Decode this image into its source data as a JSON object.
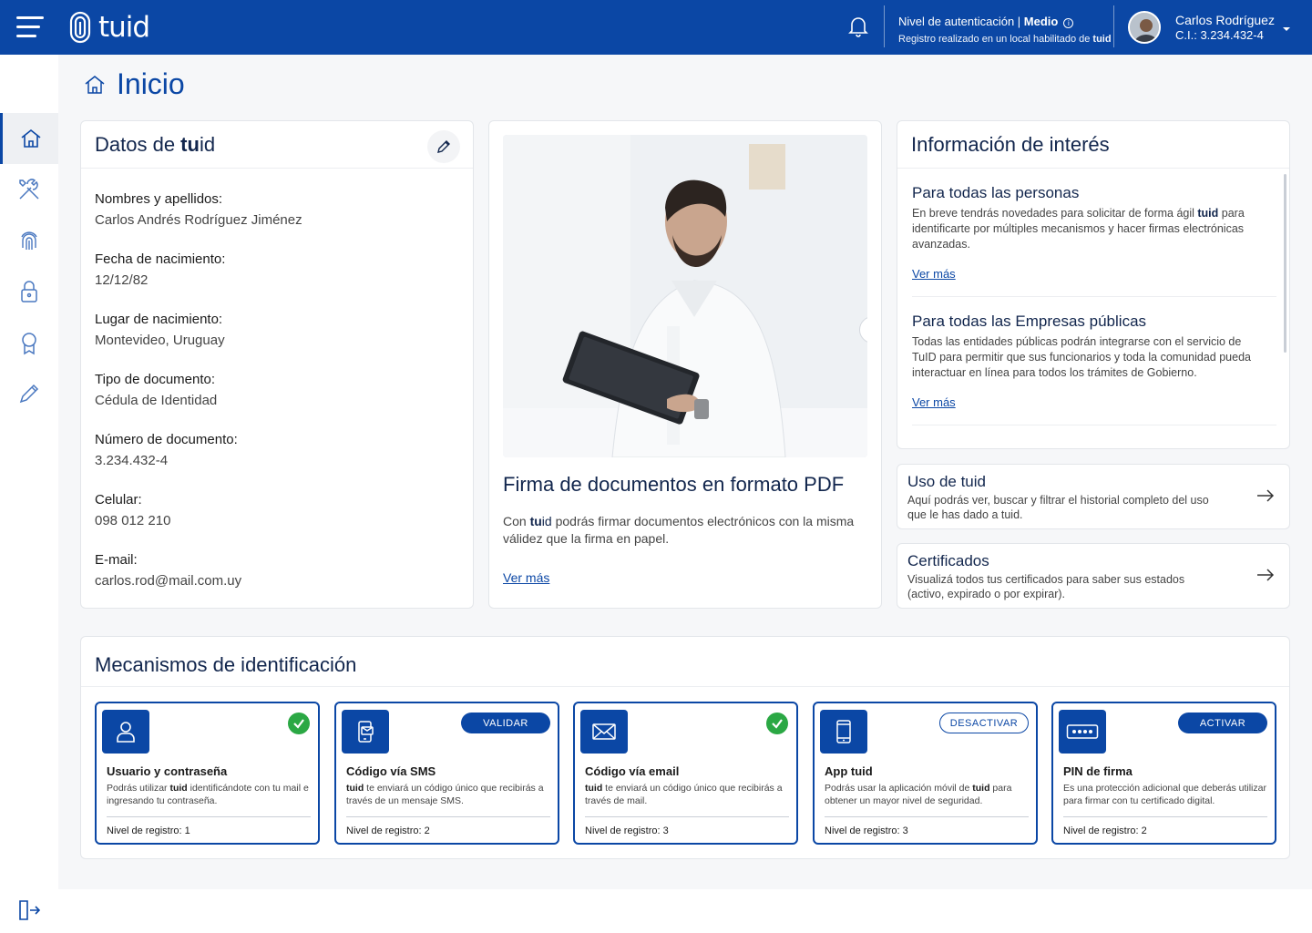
{
  "header": {
    "logo_text": "tuid",
    "auth_level_label": "Nivel de autenticación | ",
    "auth_level_value": "Medio",
    "registro_text": "Registro realizado en un local habilitado de ",
    "registro_brand": "tuid",
    "user_name": "Carlos Rodríguez",
    "user_ci": "C.I.: 3.234.432-4"
  },
  "page": {
    "title": "Inicio"
  },
  "datos": {
    "title_pre": "Datos de ",
    "title_bold": "tu",
    "title_post": "id",
    "fields": [
      {
        "label": "Nombres y apellidos:",
        "value": "Carlos Andrés Rodríguez Jiménez"
      },
      {
        "label": "Fecha de nacimiento:",
        "value": "12/12/82"
      },
      {
        "label": "Lugar de nacimiento:",
        "value": "Montevideo, Uruguay"
      },
      {
        "label": "Tipo de documento:",
        "value": "Cédula de Identidad"
      },
      {
        "label": "Número de documento:",
        "value": "3.234.432-4"
      },
      {
        "label": "Celular:",
        "value": "098 012 210"
      },
      {
        "label": "E-mail:",
        "value": "carlos.rod@mail.com.uy"
      }
    ]
  },
  "promo": {
    "title": "Firma de documentos en formato PDF",
    "desc_pre": "Con ",
    "desc_bold": "tu",
    "desc_mid": "id",
    "desc_post": " podrás firmar documentos electrónicos con la misma válidez que la firma en papel.",
    "link": "Ver más"
  },
  "info": {
    "title": "Información de interés",
    "items": [
      {
        "title": "Para todas las personas",
        "body_pre": "En breve tendrás novedades para solicitar de forma ágil ",
        "body_bold": "tuid",
        "body_post": " para identificarte por múltiples mecanismos y hacer firmas electrónicas avanzadas.",
        "link": "Ver más"
      },
      {
        "title": "Para todas las Empresas públicas",
        "body_pre": "Todas las entidades públicas podrán integrarse con el servicio de TuID para permitir que sus funcionarios y toda la comunidad pueda interactuar en línea para todos los trámites de Gobierno.",
        "body_bold": "",
        "body_post": "",
        "link": "Ver más"
      }
    ]
  },
  "uso": {
    "title": "Uso de tuid",
    "desc": "Aquí podrás ver, buscar y filtrar el historial completo del uso que le has dado a tuid."
  },
  "certificados": {
    "title": "Certificados",
    "desc": "Visualizá todos tus certificados para saber sus estados (activo, expirado o por expirar)."
  },
  "mecanismos": {
    "title": "Mecanismos de identificación",
    "items": [
      {
        "name": "Usuario y contraseña",
        "desc_pre": "Podrás utilizar ",
        "desc_bold": "tuid",
        "desc_post": " identificándote con tu mail e ingresando tu contraseña.",
        "level": "Nivel de registro: 1",
        "icon": "user-icon",
        "status": "check"
      },
      {
        "name": "Código vía SMS",
        "desc_pre": "",
        "desc_bold": "tuid",
        "desc_post": " te enviará un código único que recibirás a través de un mensaje SMS.",
        "level": "Nivel de registro: 2",
        "icon": "sms-icon",
        "status": "button",
        "button": "VALIDAR",
        "button_style": "solid"
      },
      {
        "name": "Código vía email",
        "desc_pre": "",
        "desc_bold": "tuid",
        "desc_post": " te enviará un código único que recibirás a través de mail.",
        "level": "Nivel de registro: 3",
        "icon": "email-icon",
        "status": "check"
      },
      {
        "name": "App tuid",
        "desc_pre": "Podrás usar la aplicación móvil de ",
        "desc_bold": "tuid",
        "desc_post": " para obtener un mayor nivel de seguridad.",
        "level": "Nivel de registro: 3",
        "icon": "mobile-icon",
        "status": "button",
        "button": "DESACTIVAR",
        "button_style": "outline"
      },
      {
        "name": "PIN de firma",
        "desc_pre": "Es una protección adicional que deberás utilizar para firmar con tu certificado digital.",
        "desc_bold": "",
        "desc_post": "",
        "level": "Nivel de registro: 2",
        "icon": "pin-icon",
        "status": "button",
        "button": "ACTIVAR",
        "button_style": "solid"
      }
    ]
  },
  "colors": {
    "brand": "#0b47a5",
    "success": "#2ba844"
  }
}
